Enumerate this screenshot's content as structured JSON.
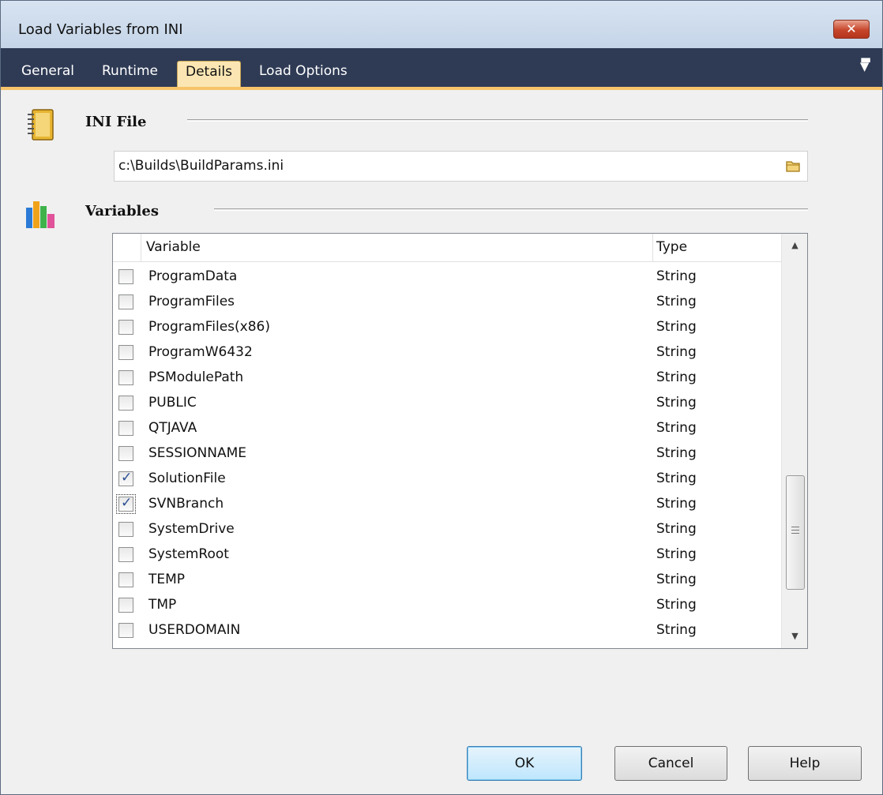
{
  "window": {
    "title": "Load Variables from INI",
    "close_label": "✕"
  },
  "tabs": [
    {
      "label": "General"
    },
    {
      "label": "Runtime"
    },
    {
      "label": "Details",
      "active": true
    },
    {
      "label": "Load Options"
    }
  ],
  "ini_section": {
    "label": "INI File",
    "path": "c:\\Builds\\BuildParams.ini"
  },
  "variables_section": {
    "label": "Variables"
  },
  "grid": {
    "columns": [
      "Variable",
      "Type"
    ],
    "rows": [
      {
        "name": "ProgramData",
        "type": "String",
        "checked": false
      },
      {
        "name": "ProgramFiles",
        "type": "String",
        "checked": false
      },
      {
        "name": "ProgramFiles(x86)",
        "type": "String",
        "checked": false
      },
      {
        "name": "ProgramW6432",
        "type": "String",
        "checked": false
      },
      {
        "name": "PSModulePath",
        "type": "String",
        "checked": false
      },
      {
        "name": "PUBLIC",
        "type": "String",
        "checked": false
      },
      {
        "name": "QTJAVA",
        "type": "String",
        "checked": false
      },
      {
        "name": "SESSIONNAME",
        "type": "String",
        "checked": false
      },
      {
        "name": "SolutionFile",
        "type": "String",
        "checked": true
      },
      {
        "name": "SVNBranch",
        "type": "String",
        "checked": true,
        "focused": true
      },
      {
        "name": "SystemDrive",
        "type": "String",
        "checked": false
      },
      {
        "name": "SystemRoot",
        "type": "String",
        "checked": false
      },
      {
        "name": "TEMP",
        "type": "String",
        "checked": false
      },
      {
        "name": "TMP",
        "type": "String",
        "checked": false
      },
      {
        "name": "USERDOMAIN",
        "type": "String",
        "checked": false
      }
    ]
  },
  "buttons": {
    "ok": "OK",
    "cancel": "Cancel",
    "help": "Help"
  },
  "colors": {
    "tab_bar": "#2f3b55",
    "tab_accent": "#f7c46b",
    "active_tab": "#fbe6b3",
    "check": "#2a4d93"
  }
}
